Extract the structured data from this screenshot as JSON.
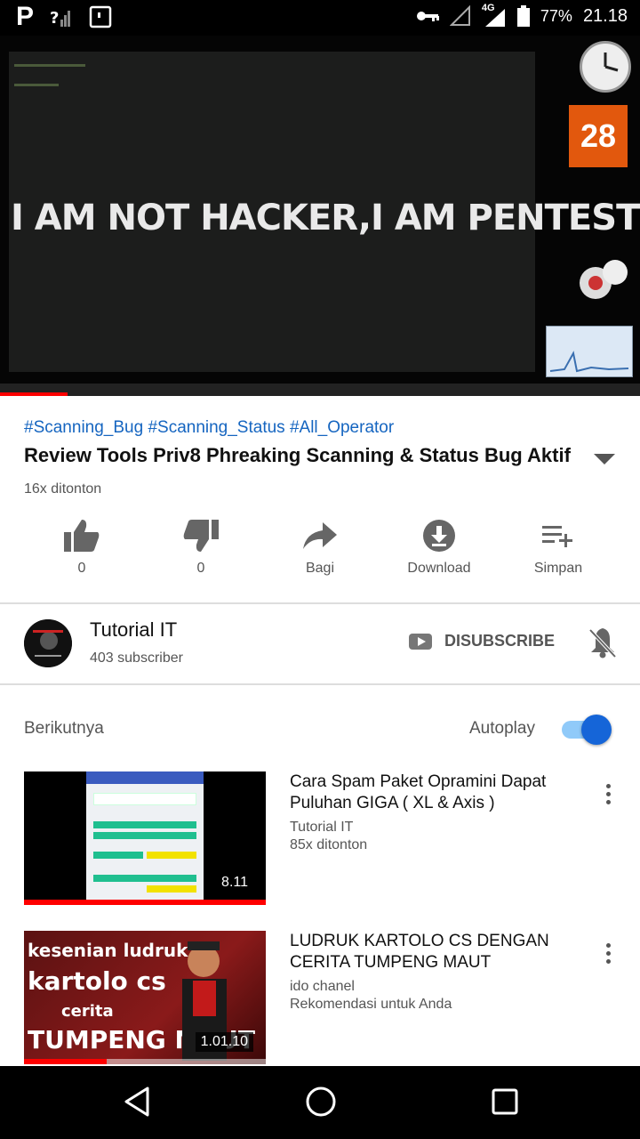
{
  "status_bar": {
    "left_icon": "P",
    "network": "4G",
    "battery": "77%",
    "time": "21.18",
    "icons": [
      "key-icon",
      "signal-icon",
      "battery-icon"
    ]
  },
  "video": {
    "caption": "I AM NOT HACKER,I AM PENTESTING",
    "calendar_day": "28",
    "progress_fraction": 0.105
  },
  "info": {
    "hashtags": "#Scanning_Bug #Scanning_Status #All_Operator",
    "title": "Review Tools Priv8 Phreaking Scanning & Status Bug Aktif",
    "views": "16x ditonton"
  },
  "actions": {
    "like_count": "0",
    "dislike_count": "0",
    "share_label": "Bagi",
    "download_label": "Download",
    "save_label": "Simpan"
  },
  "channel": {
    "name": "Tutorial IT",
    "subscribers": "403 subscriber",
    "unsubscribe_label": "DISUBSCRIBE"
  },
  "up_next": {
    "label": "Berikutnya",
    "autoplay_label": "Autoplay",
    "autoplay_on": true
  },
  "recommendations": [
    {
      "title": "Cara Spam Paket Opramini Dapat Puluhan GIGA ( XL & Axis )",
      "channel": "Tutorial IT",
      "meta": "85x ditonton",
      "duration": "8.11",
      "progress_fraction": 1.0
    },
    {
      "title": "LUDRUK KARTOLO CS DENGAN CERITA TUMPENG MAUT",
      "channel": "ido chanel",
      "meta": "Rekomendasi untuk Anda",
      "duration": "1.01.10",
      "progress_fraction": 0.34,
      "thumb_text_1": "kesenian ludruk",
      "thumb_text_2": "kartolo cs",
      "thumb_text_3": "cerita",
      "thumb_text_4": "TUMPENG MAUT"
    }
  ],
  "colors": {
    "link": "#1565c0",
    "accent_red": "#ff0000",
    "toggle": "#1565d8"
  }
}
